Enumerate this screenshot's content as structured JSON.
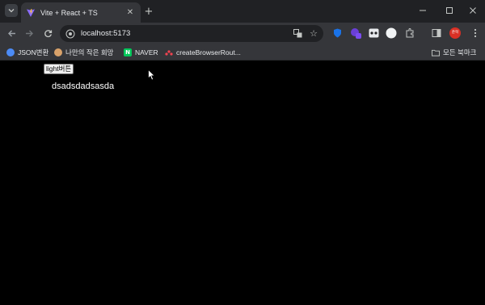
{
  "browser": {
    "tab": {
      "title": "Vite + React + TS"
    },
    "omnibox": {
      "url": "localhost:5173"
    },
    "bookmarks": [
      {
        "label": "JSON변환",
        "icon": "globe-icon"
      },
      {
        "label": "나만의 작은 회망",
        "icon": "person-icon"
      },
      {
        "label": "NAVER",
        "icon": "naver-icon"
      },
      {
        "label": "createBrowserRout...",
        "icon": "react-router-icon"
      }
    ],
    "all_bookmarks_label": "모든 북마크",
    "profile_label": "준혁"
  },
  "page": {
    "button_label": "light버튼",
    "text": "dsadsdadsasda"
  },
  "colors": {
    "tabstrip": "#202124",
    "toolbar": "#35363a",
    "page_background": "#000000",
    "page_text": "#ffffff",
    "profile_accent": "#d93025"
  }
}
